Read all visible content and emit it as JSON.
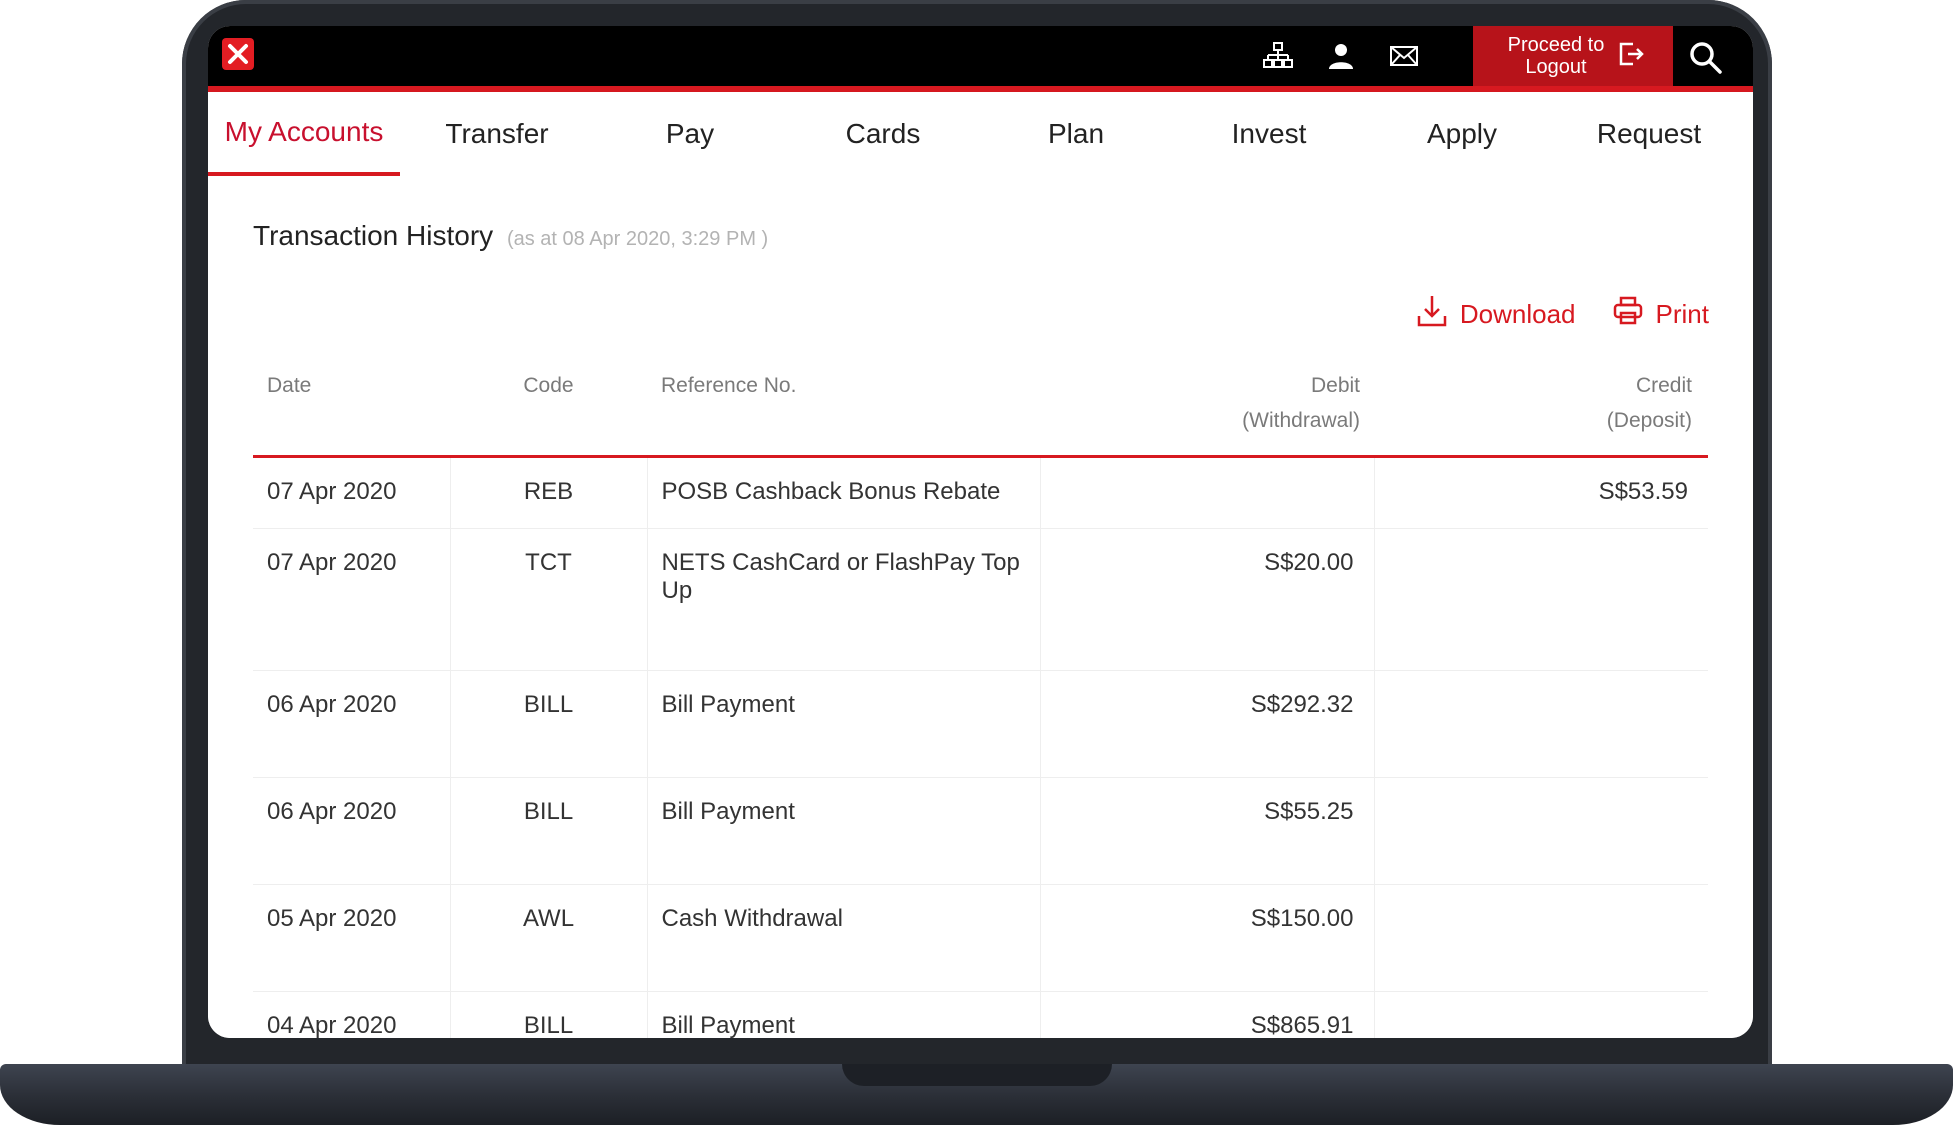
{
  "header": {
    "logout_label_line1": "Proceed to",
    "logout_label_line2": "Logout",
    "icons": [
      "sitemap-icon",
      "user-icon",
      "mail-icon",
      "logout-icon",
      "search-icon"
    ]
  },
  "nav": {
    "items": [
      {
        "label": "My Accounts"
      },
      {
        "label": "Transfer"
      },
      {
        "label": "Pay"
      },
      {
        "label": "Cards"
      },
      {
        "label": "Plan"
      },
      {
        "label": "Invest"
      },
      {
        "label": "Apply"
      },
      {
        "label": "Request"
      }
    ],
    "active_index": 0
  },
  "page": {
    "title": "Transaction History",
    "subtitle": "(as at 08 Apr 2020, 3:29 PM )",
    "download_label": "Download",
    "print_label": "Print"
  },
  "table": {
    "headers": {
      "date": "Date",
      "code": "Code",
      "reference": "Reference No.",
      "debit_line1": "Debit",
      "debit_line2": "(Withdrawal)",
      "credit_line1": "Credit",
      "credit_line2": "(Deposit)"
    },
    "rows": [
      {
        "date": "07 Apr 2020",
        "code": "REB",
        "reference": "POSB Cashback Bonus Rebate",
        "debit": "",
        "credit": "S$53.59"
      },
      {
        "date": "07 Apr 2020",
        "code": "TCT",
        "reference": "NETS CashCard or FlashPay Top Up",
        "debit": "S$20.00",
        "credit": ""
      },
      {
        "date": "06 Apr 2020",
        "code": "BILL",
        "reference": "Bill Payment",
        "debit": "S$292.32",
        "credit": ""
      },
      {
        "date": "06 Apr 2020",
        "code": "BILL",
        "reference": "Bill Payment",
        "debit": "S$55.25",
        "credit": ""
      },
      {
        "date": "05 Apr 2020",
        "code": "AWL",
        "reference": "Cash Withdrawal",
        "debit": "S$150.00",
        "credit": ""
      },
      {
        "date": "04 Apr 2020",
        "code": "BILL",
        "reference": "Bill Payment",
        "debit": "S$865.91",
        "credit": ""
      }
    ]
  },
  "colors": {
    "brand_red": "#d71920",
    "active_nav_text": "#c8102e",
    "logout_bg": "#b7131a"
  }
}
